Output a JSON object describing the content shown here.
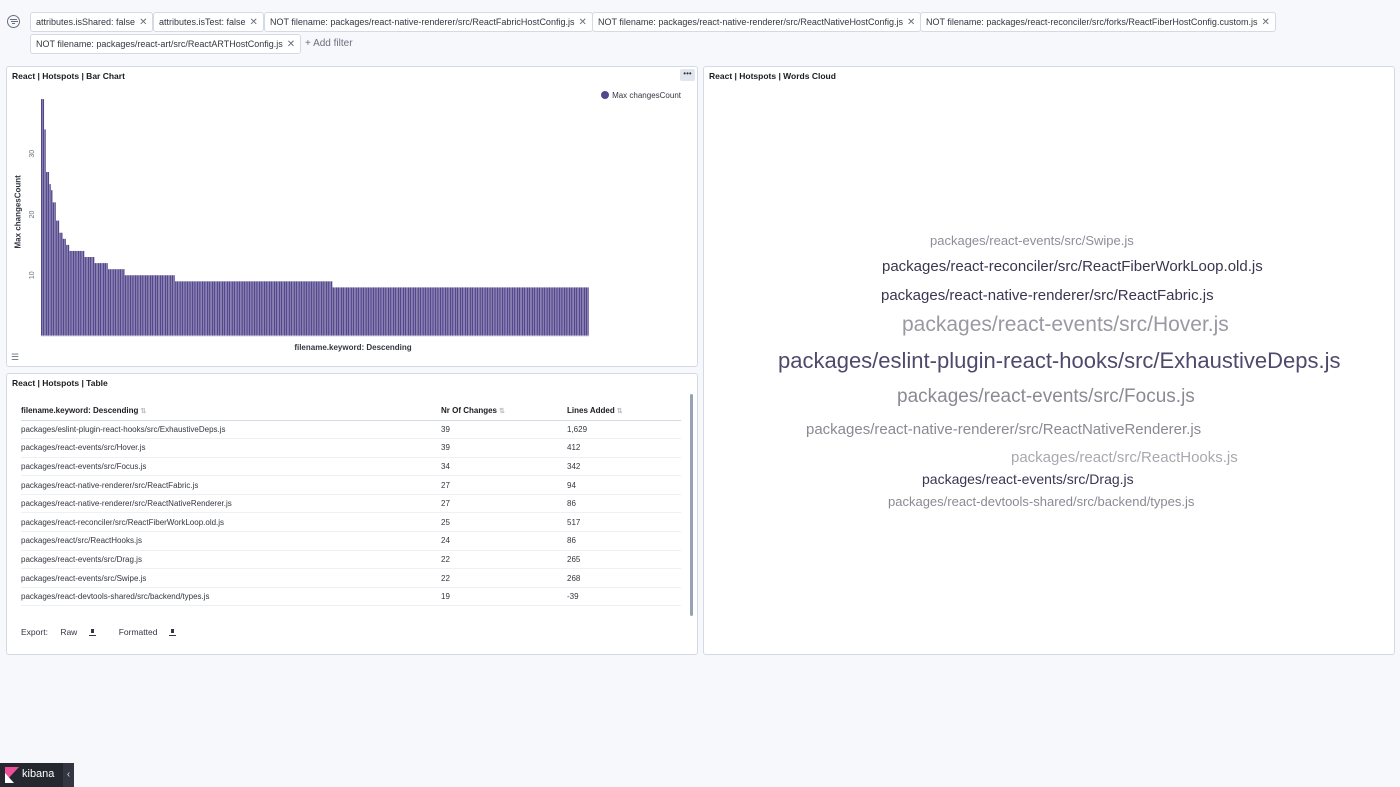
{
  "filters": [
    "attributes.isShared: false",
    "attributes.isTest: false",
    "NOT filename: packages/react-native-renderer/src/ReactFabricHostConfig.js",
    "NOT filename: packages/react-native-renderer/src/ReactNativeHostConfig.js",
    "NOT filename: packages/react-reconciler/src/forks/ReactFiberHostConfig.custom.js",
    "NOT filename: packages/react-art/src/ReactARTHostConfig.js"
  ],
  "add_filter_label": "+ Add filter",
  "bar_panel": {
    "title": "React | Hotspots | Bar Chart",
    "menu_label": "•••"
  },
  "chart_data": {
    "type": "bar",
    "legend": [
      "Max changesCount"
    ],
    "legend_position": "top-right",
    "ylabel": "Max changesCount",
    "xlabel": "filename.keyword: Descending",
    "yticks": [
      10,
      20,
      30
    ],
    "ylim": [
      0,
      40
    ],
    "values": [
      39,
      39,
      34,
      27,
      27,
      25,
      24,
      22,
      22,
      19,
      19,
      17,
      17,
      16,
      16,
      15,
      15,
      14,
      14,
      14,
      14,
      14,
      14,
      14,
      14,
      14,
      13,
      13,
      13,
      13,
      13,
      13,
      12,
      12,
      12,
      12,
      12,
      12,
      12,
      12,
      11,
      11,
      11,
      11,
      11,
      11,
      11,
      11,
      11,
      11,
      10,
      10,
      10,
      10,
      10,
      10,
      10,
      10,
      10,
      10,
      10,
      10,
      10,
      10,
      10,
      10,
      10,
      10,
      10,
      10,
      10,
      10,
      10,
      10,
      10,
      10,
      10,
      10,
      10,
      10,
      9,
      9,
      9,
      9,
      9,
      9,
      9,
      9,
      9,
      9,
      9,
      9,
      9,
      9,
      9,
      9,
      9,
      9,
      9,
      9,
      9,
      9,
      9,
      9,
      9,
      9,
      9,
      9,
      9,
      9,
      9,
      9,
      9,
      9,
      9,
      9,
      9,
      9,
      9,
      9,
      9,
      9,
      9,
      9,
      9,
      9,
      9,
      9,
      9,
      9,
      9,
      9,
      9,
      9,
      9,
      9,
      9,
      9,
      9,
      9,
      9,
      9,
      9,
      9,
      9,
      9,
      9,
      9,
      9,
      9,
      9,
      9,
      9,
      9,
      9,
      9,
      9,
      9,
      9,
      9,
      9,
      9,
      9,
      9,
      9,
      9,
      9,
      9,
      9,
      9,
      9,
      9,
      9,
      9,
      8,
      8,
      8,
      8,
      8,
      8,
      8,
      8,
      8,
      8,
      8,
      8,
      8,
      8,
      8,
      8,
      8,
      8,
      8,
      8,
      8,
      8,
      8,
      8,
      8,
      8,
      8,
      8,
      8,
      8,
      8,
      8,
      8,
      8,
      8,
      8,
      8,
      8,
      8,
      8,
      8,
      8,
      8,
      8,
      8,
      8,
      8,
      8,
      8,
      8,
      8,
      8,
      8,
      8,
      8,
      8,
      8,
      8,
      8,
      8,
      8,
      8,
      8,
      8,
      8,
      8,
      8,
      8,
      8,
      8,
      8,
      8,
      8,
      8,
      8,
      8,
      8,
      8,
      8,
      8,
      8,
      8,
      8,
      8,
      8,
      8,
      8,
      8,
      8,
      8,
      8,
      8,
      8,
      8,
      8,
      8,
      8,
      8,
      8,
      8,
      8,
      8,
      8,
      8,
      8,
      8,
      8,
      8,
      8,
      8,
      8,
      8,
      8,
      8,
      8,
      8,
      8,
      8,
      8,
      8,
      8,
      8,
      8,
      8,
      8,
      8,
      8,
      8,
      8,
      8,
      8,
      8,
      8,
      8,
      8,
      8,
      8,
      8,
      8,
      8,
      8,
      8,
      8,
      8,
      8,
      8,
      8,
      8,
      8,
      8,
      8,
      8,
      8
    ],
    "bar_color": "#54478d"
  },
  "table_panel": {
    "title": "React | Hotspots | Table",
    "columns": [
      "filename.keyword: Descending",
      "Nr Of Changes",
      "Lines Added"
    ],
    "rows": [
      [
        "packages/eslint-plugin-react-hooks/src/ExhaustiveDeps.js",
        "39",
        "1,629"
      ],
      [
        "packages/react-events/src/Hover.js",
        "39",
        "412"
      ],
      [
        "packages/react-events/src/Focus.js",
        "34",
        "342"
      ],
      [
        "packages/react-native-renderer/src/ReactFabric.js",
        "27",
        "94"
      ],
      [
        "packages/react-native-renderer/src/ReactNativeRenderer.js",
        "27",
        "86"
      ],
      [
        "packages/react-reconciler/src/ReactFiberWorkLoop.old.js",
        "25",
        "517"
      ],
      [
        "packages/react/src/ReactHooks.js",
        "24",
        "86"
      ],
      [
        "packages/react-events/src/Drag.js",
        "22",
        "265"
      ],
      [
        "packages/react-events/src/Swipe.js",
        "22",
        "268"
      ],
      [
        "packages/react-devtools-shared/src/backend/types.js",
        "19",
        "-39"
      ]
    ],
    "export_label": "Export:",
    "export_raw": "Raw",
    "export_formatted": "Formatted"
  },
  "words_panel": {
    "title": "React | Hotspots | Words Cloud",
    "words": [
      {
        "text": "packages/react-events/src/Swipe.js",
        "color": "#8e8e99"
      },
      {
        "text": "packages/react-reconciler/src/ReactFiberWorkLoop.old.js",
        "color": "#3a3650"
      },
      {
        "text": "packages/react-native-renderer/src/ReactFabric.js",
        "color": "#3a3650"
      },
      {
        "text": "packages/react-events/src/Hover.js",
        "color": "#9a99a3"
      },
      {
        "text": "packages/eslint-plugin-react-hooks/src/ExhaustiveDeps.js",
        "color": "#4f4a6b"
      },
      {
        "text": "packages/react-events/src/Focus.js",
        "color": "#8a8a94"
      },
      {
        "text": "packages/react-native-renderer/src/ReactNativeRenderer.js",
        "color": "#8a8a94"
      },
      {
        "text": "packages/react/src/ReactHooks.js",
        "color": "#a8a8b0"
      },
      {
        "text": "packages/react-events/src/Drag.js",
        "color": "#3a3650"
      },
      {
        "text": "packages/react-devtools-shared/src/backend/types.js",
        "color": "#8a8a94"
      }
    ]
  },
  "badge": {
    "text": "kibana",
    "collapse": "‹"
  }
}
